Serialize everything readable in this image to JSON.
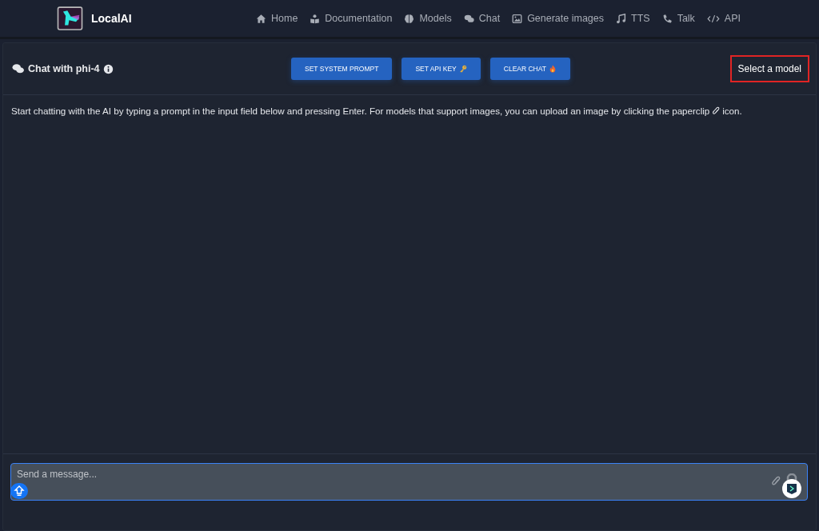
{
  "brand": {
    "name": "LocalAI"
  },
  "nav": [
    {
      "kind": "home",
      "label": "Home"
    },
    {
      "kind": "docs",
      "label": "Documentation"
    },
    {
      "kind": "models",
      "label": "Models"
    },
    {
      "kind": "chat",
      "label": "Chat"
    },
    {
      "kind": "images",
      "label": "Generate images"
    },
    {
      "kind": "tts",
      "label": "TTS"
    },
    {
      "kind": "talk",
      "label": "Talk"
    },
    {
      "kind": "api",
      "label": "API"
    }
  ],
  "chat": {
    "title": "Chat with phi-4",
    "buttons": [
      {
        "kind": "prompt",
        "label": "SET SYSTEM PROMPT"
      },
      {
        "kind": "key",
        "label": "SET API KEY"
      },
      {
        "kind": "clear",
        "label": "CLEAR CHAT"
      }
    ],
    "model_select": {
      "placeholder": "Select a model",
      "highlighted": true
    },
    "intro": "Start chatting with the AI by typing a prompt in the input field below and pressing Enter. For models that support images, you can upload an image by clicking the paperclip",
    "intro_end": "icon.",
    "input": {
      "placeholder": "Send a message..."
    }
  }
}
